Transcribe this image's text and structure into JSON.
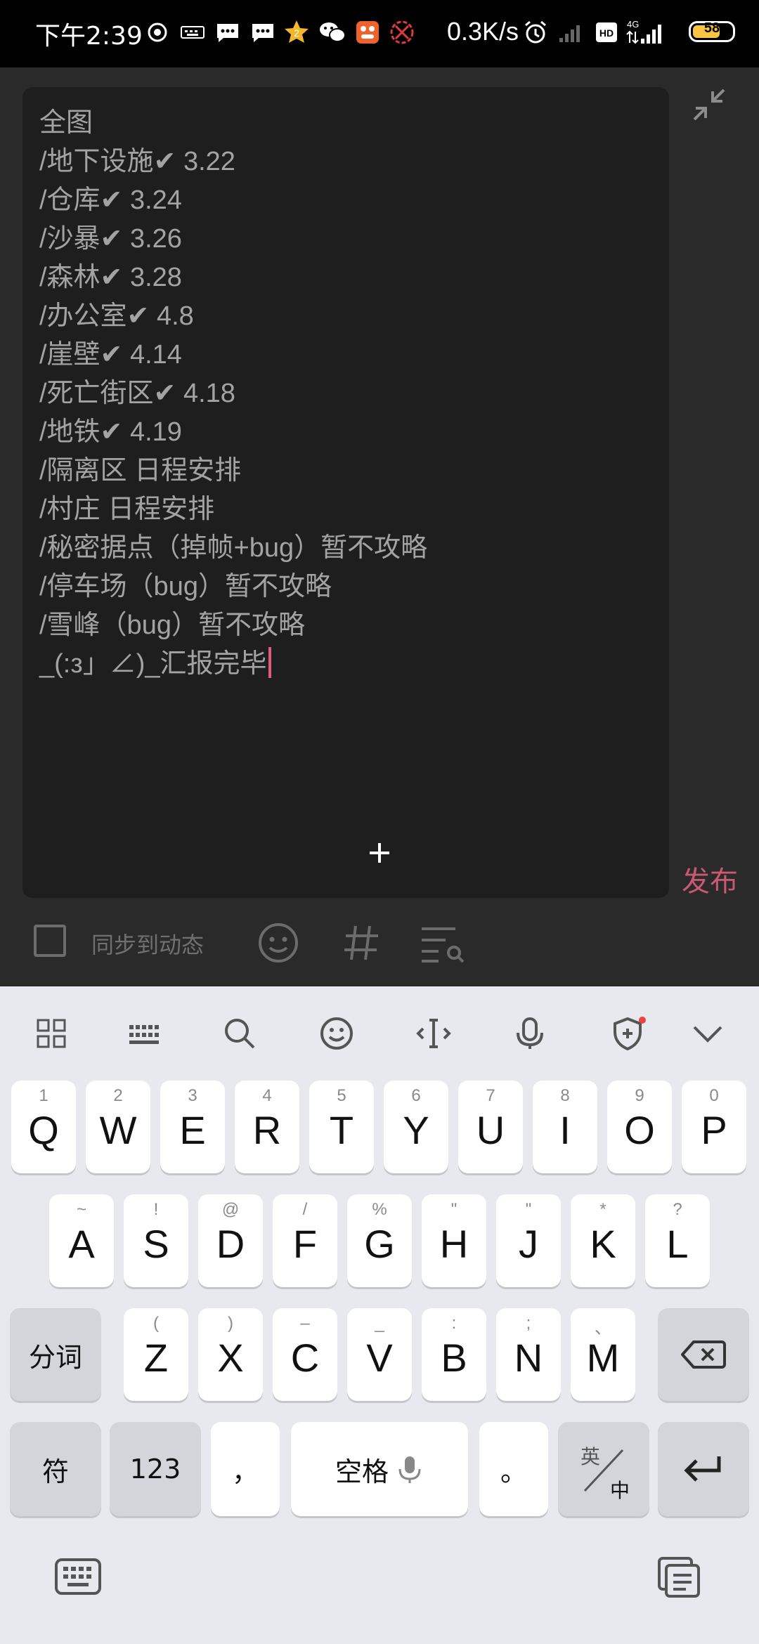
{
  "status_bar": {
    "time": "下午2:39",
    "network_speed": "0.3K/s",
    "network_type": "4G",
    "hd_label": "HD",
    "battery_level": "58"
  },
  "editor": {
    "lines": [
      "全图",
      "/地下设施✔ 3.22",
      "/仓库✔ 3.24",
      "/沙暴✔ 3.26",
      "/森林✔ 3.28",
      "/办公室✔ 4.8",
      "/崖壁✔ 4.14",
      "/死亡街区✔ 4.18",
      "/地铁✔ 4.19",
      "/隔离区 日程安排",
      "/村庄 日程安排",
      "/秘密据点（掉帧+bug）暂不攻略",
      "/停车场（bug）暂不攻略",
      "/雪峰（bug）暂不攻略",
      "_(:з」∠)_汇报完毕"
    ],
    "publish_label": "发布"
  },
  "bottom_bar": {
    "sync_label": "同步到动态"
  },
  "keyboard": {
    "row1": [
      {
        "sub": "1",
        "main": "Q"
      },
      {
        "sub": "2",
        "main": "W"
      },
      {
        "sub": "3",
        "main": "E"
      },
      {
        "sub": "4",
        "main": "R"
      },
      {
        "sub": "5",
        "main": "T"
      },
      {
        "sub": "6",
        "main": "Y"
      },
      {
        "sub": "7",
        "main": "U"
      },
      {
        "sub": "8",
        "main": "I"
      },
      {
        "sub": "9",
        "main": "O"
      },
      {
        "sub": "0",
        "main": "P"
      }
    ],
    "row2": [
      {
        "sub": "~",
        "main": "A"
      },
      {
        "sub": "!",
        "main": "S"
      },
      {
        "sub": "@",
        "main": "D"
      },
      {
        "sub": "/",
        "main": "F"
      },
      {
        "sub": "%",
        "main": "G"
      },
      {
        "sub": "\"",
        "main": "H"
      },
      {
        "sub": "\"",
        "main": "J"
      },
      {
        "sub": "*",
        "main": "K"
      },
      {
        "sub": "?",
        "main": "L"
      }
    ],
    "row3": [
      {
        "sub": "(",
        "main": "Z"
      },
      {
        "sub": ")",
        "main": "X"
      },
      {
        "sub": "–",
        "main": "C"
      },
      {
        "sub": "_",
        "main": "V"
      },
      {
        "sub": ":",
        "main": "B"
      },
      {
        "sub": ";",
        "main": "N"
      },
      {
        "sub": "、",
        "main": "M"
      }
    ],
    "segment_label": "分词",
    "symbol_label": "符",
    "num_label": "123",
    "comma_label": "，",
    "space_label": "空格",
    "period_label": "。",
    "lang_en": "英",
    "lang_zh": "中"
  }
}
